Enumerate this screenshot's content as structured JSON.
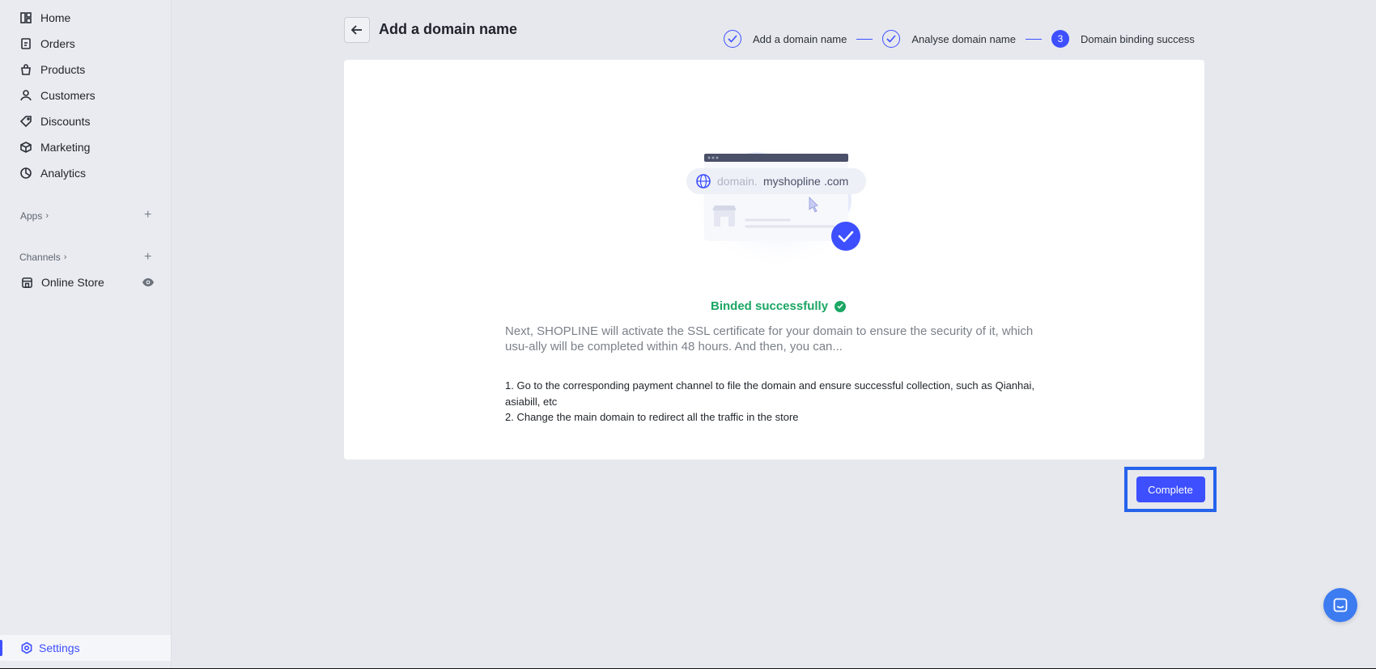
{
  "sidebar": {
    "items": [
      {
        "label": "Home",
        "icon": "home-icon"
      },
      {
        "label": "Orders",
        "icon": "orders-icon"
      },
      {
        "label": "Products",
        "icon": "products-icon"
      },
      {
        "label": "Customers",
        "icon": "customers-icon"
      },
      {
        "label": "Discounts",
        "icon": "discounts-icon"
      },
      {
        "label": "Marketing",
        "icon": "marketing-icon"
      },
      {
        "label": "Analytics",
        "icon": "analytics-icon"
      }
    ],
    "apps_label": "Apps",
    "channels_label": "Channels",
    "online_store_label": "Online Store",
    "settings_label": "Settings"
  },
  "header": {
    "title": "Add a domain name"
  },
  "steps": [
    {
      "label": "Add a domain name",
      "status": "done"
    },
    {
      "label": "Analyse domain name",
      "status": "done"
    },
    {
      "label": "Domain binding success",
      "status": "active",
      "number": "3"
    }
  ],
  "illustration": {
    "domain_prefix": "domain.",
    "domain_name": "myshopline",
    "domain_suffix": ".com"
  },
  "result": {
    "title": "Binded successfully",
    "description": "Next, SHOPLINE will activate the SSL certificate for your domain to ensure the security of it, which usu-ally will be completed within 48 hours. And then, you can...",
    "steps": [
      "1. Go to the corresponding payment channel to file the domain and ensure successful collection, such as Qianhai, asiabill, etc",
      "2. Change the main domain to redirect all the traffic in the store"
    ]
  },
  "actions": {
    "complete_label": "Complete"
  },
  "colors": {
    "accent": "#3d4fff",
    "success": "#1ba664",
    "highlight": "#2563eb"
  }
}
